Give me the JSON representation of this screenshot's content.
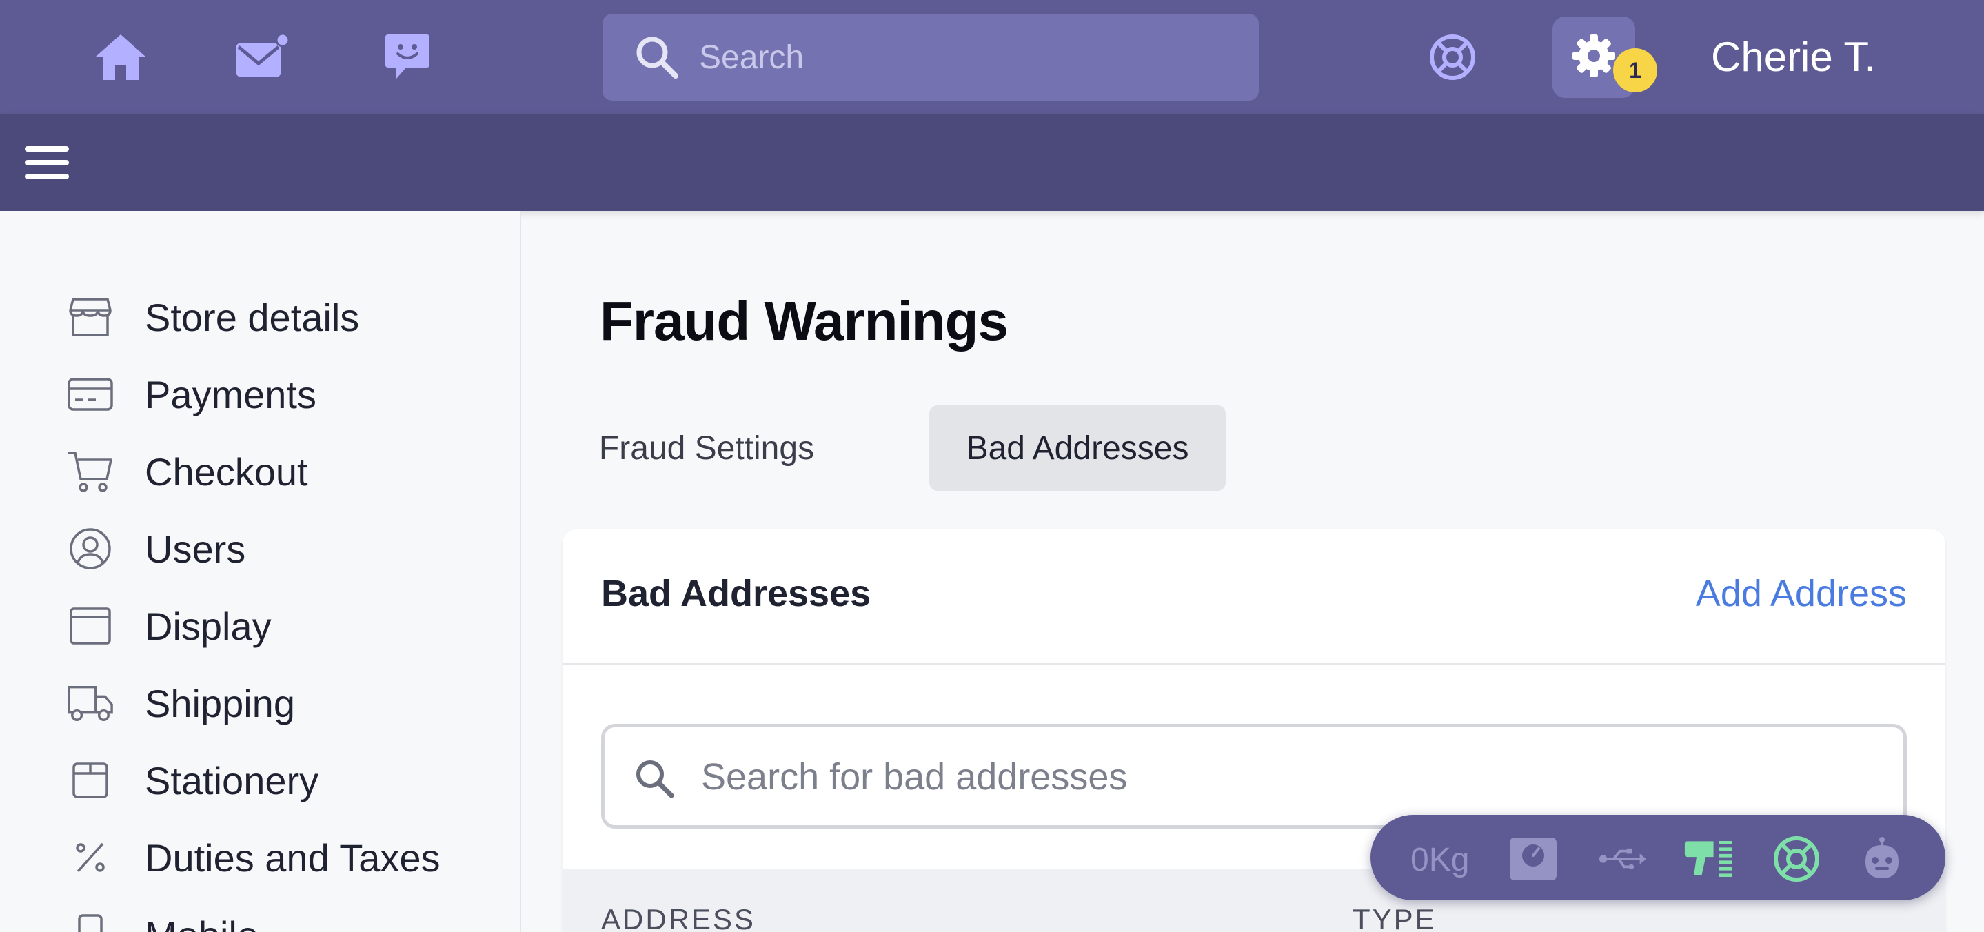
{
  "topbar": {
    "search_placeholder": "Search",
    "notification_count": "1",
    "username": "Cherie T.",
    "icons": [
      "home-icon",
      "mail-icon",
      "chat-icon",
      "help-icon",
      "gear-icon"
    ]
  },
  "sidebar": {
    "items": [
      {
        "label": "Store details",
        "icon": "store-icon"
      },
      {
        "label": "Payments",
        "icon": "card-icon"
      },
      {
        "label": "Checkout",
        "icon": "cart-icon"
      },
      {
        "label": "Users",
        "icon": "user-icon"
      },
      {
        "label": "Display",
        "icon": "window-icon"
      },
      {
        "label": "Shipping",
        "icon": "truck-icon"
      },
      {
        "label": "Stationery",
        "icon": "box-icon"
      },
      {
        "label": "Duties and Taxes",
        "icon": "percent-icon"
      },
      {
        "label": "Mobile",
        "icon": "phone-icon"
      }
    ]
  },
  "main": {
    "title": "Fraud Warnings",
    "tabs": [
      {
        "label": "Fraud Settings",
        "active": false
      },
      {
        "label": "Bad Addresses",
        "active": true
      }
    ],
    "card": {
      "title": "Bad Addresses",
      "action_label": "Add Address",
      "search_placeholder": "Search for bad addresses",
      "columns": [
        "ADDRESS",
        "TYPE"
      ]
    }
  },
  "floating_toolbar": {
    "weight": "0Kg",
    "icons": [
      "scale-icon",
      "usb-icon",
      "scanner-icon",
      "help-icon",
      "robot-icon"
    ]
  },
  "colors": {
    "topbar": "#5d5a94",
    "subbar": "#4c4a7a",
    "icon_lavender": "#b3b1ff",
    "link": "#4a7be0",
    "badge": "#f8d447",
    "accent_green": "#7ee0a8"
  }
}
